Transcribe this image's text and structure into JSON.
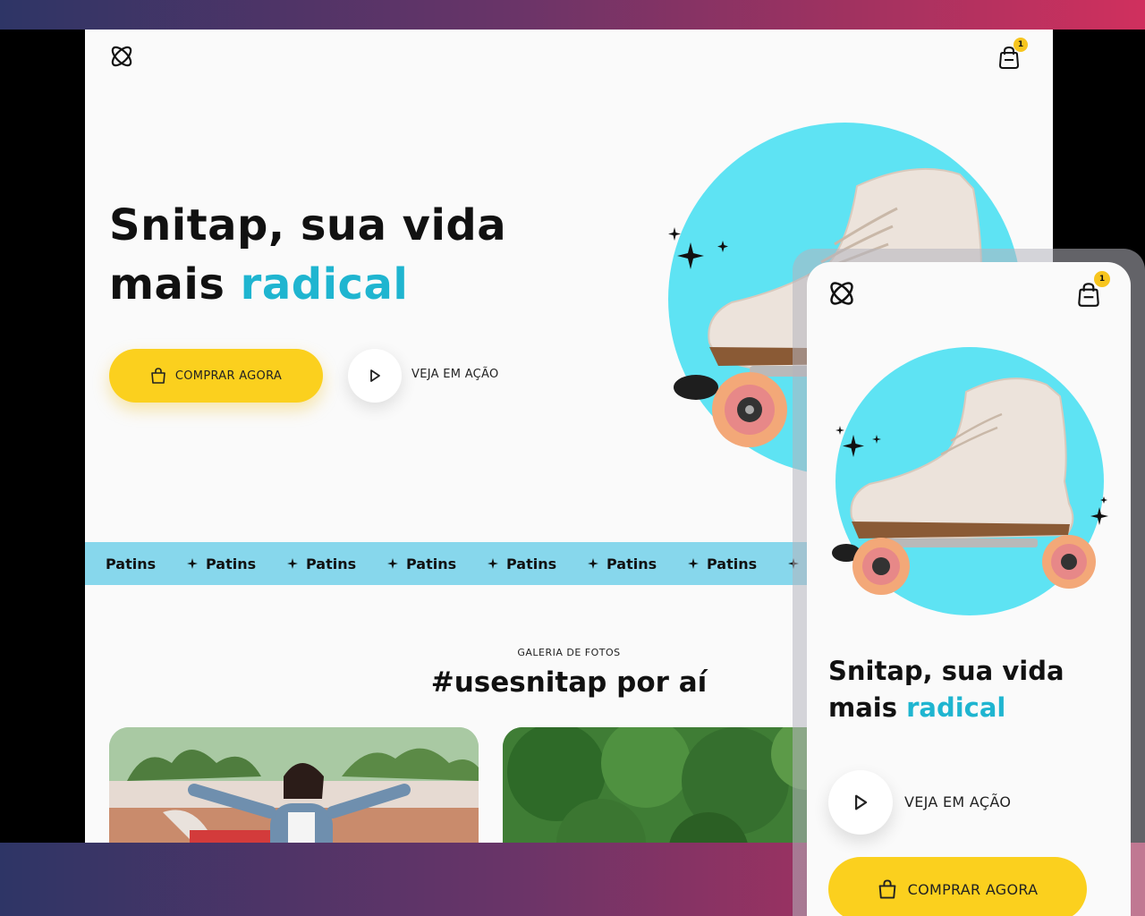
{
  "header": {
    "cart_count": "1"
  },
  "hero": {
    "title_line1": "Snitap, sua vida",
    "title_line2_prefix": "mais ",
    "title_accent": "radical",
    "buy_label": "COMPRAR AGORA",
    "play_label": "VEJA EM AÇÃO"
  },
  "marquee": {
    "items": [
      "Patins",
      "Patins",
      "Patins",
      "Patins",
      "Patins",
      "Patins",
      "Patins"
    ]
  },
  "gallery": {
    "label": "GALERIA DE FOTOS",
    "title": "#usesnitap por aí"
  },
  "mobile": {
    "cart_count": "1",
    "title_line1": "Snitap, sua vida",
    "title_line2_prefix": "mais ",
    "title_accent": "radical",
    "play_label": "VEJA EM AÇÃO",
    "buy_label": "COMPRAR AGORA"
  },
  "colors": {
    "accent": "#1fb5d0",
    "button": "#fbd01e",
    "circle": "#5ee3f3",
    "marquee": "#87d7ec"
  }
}
